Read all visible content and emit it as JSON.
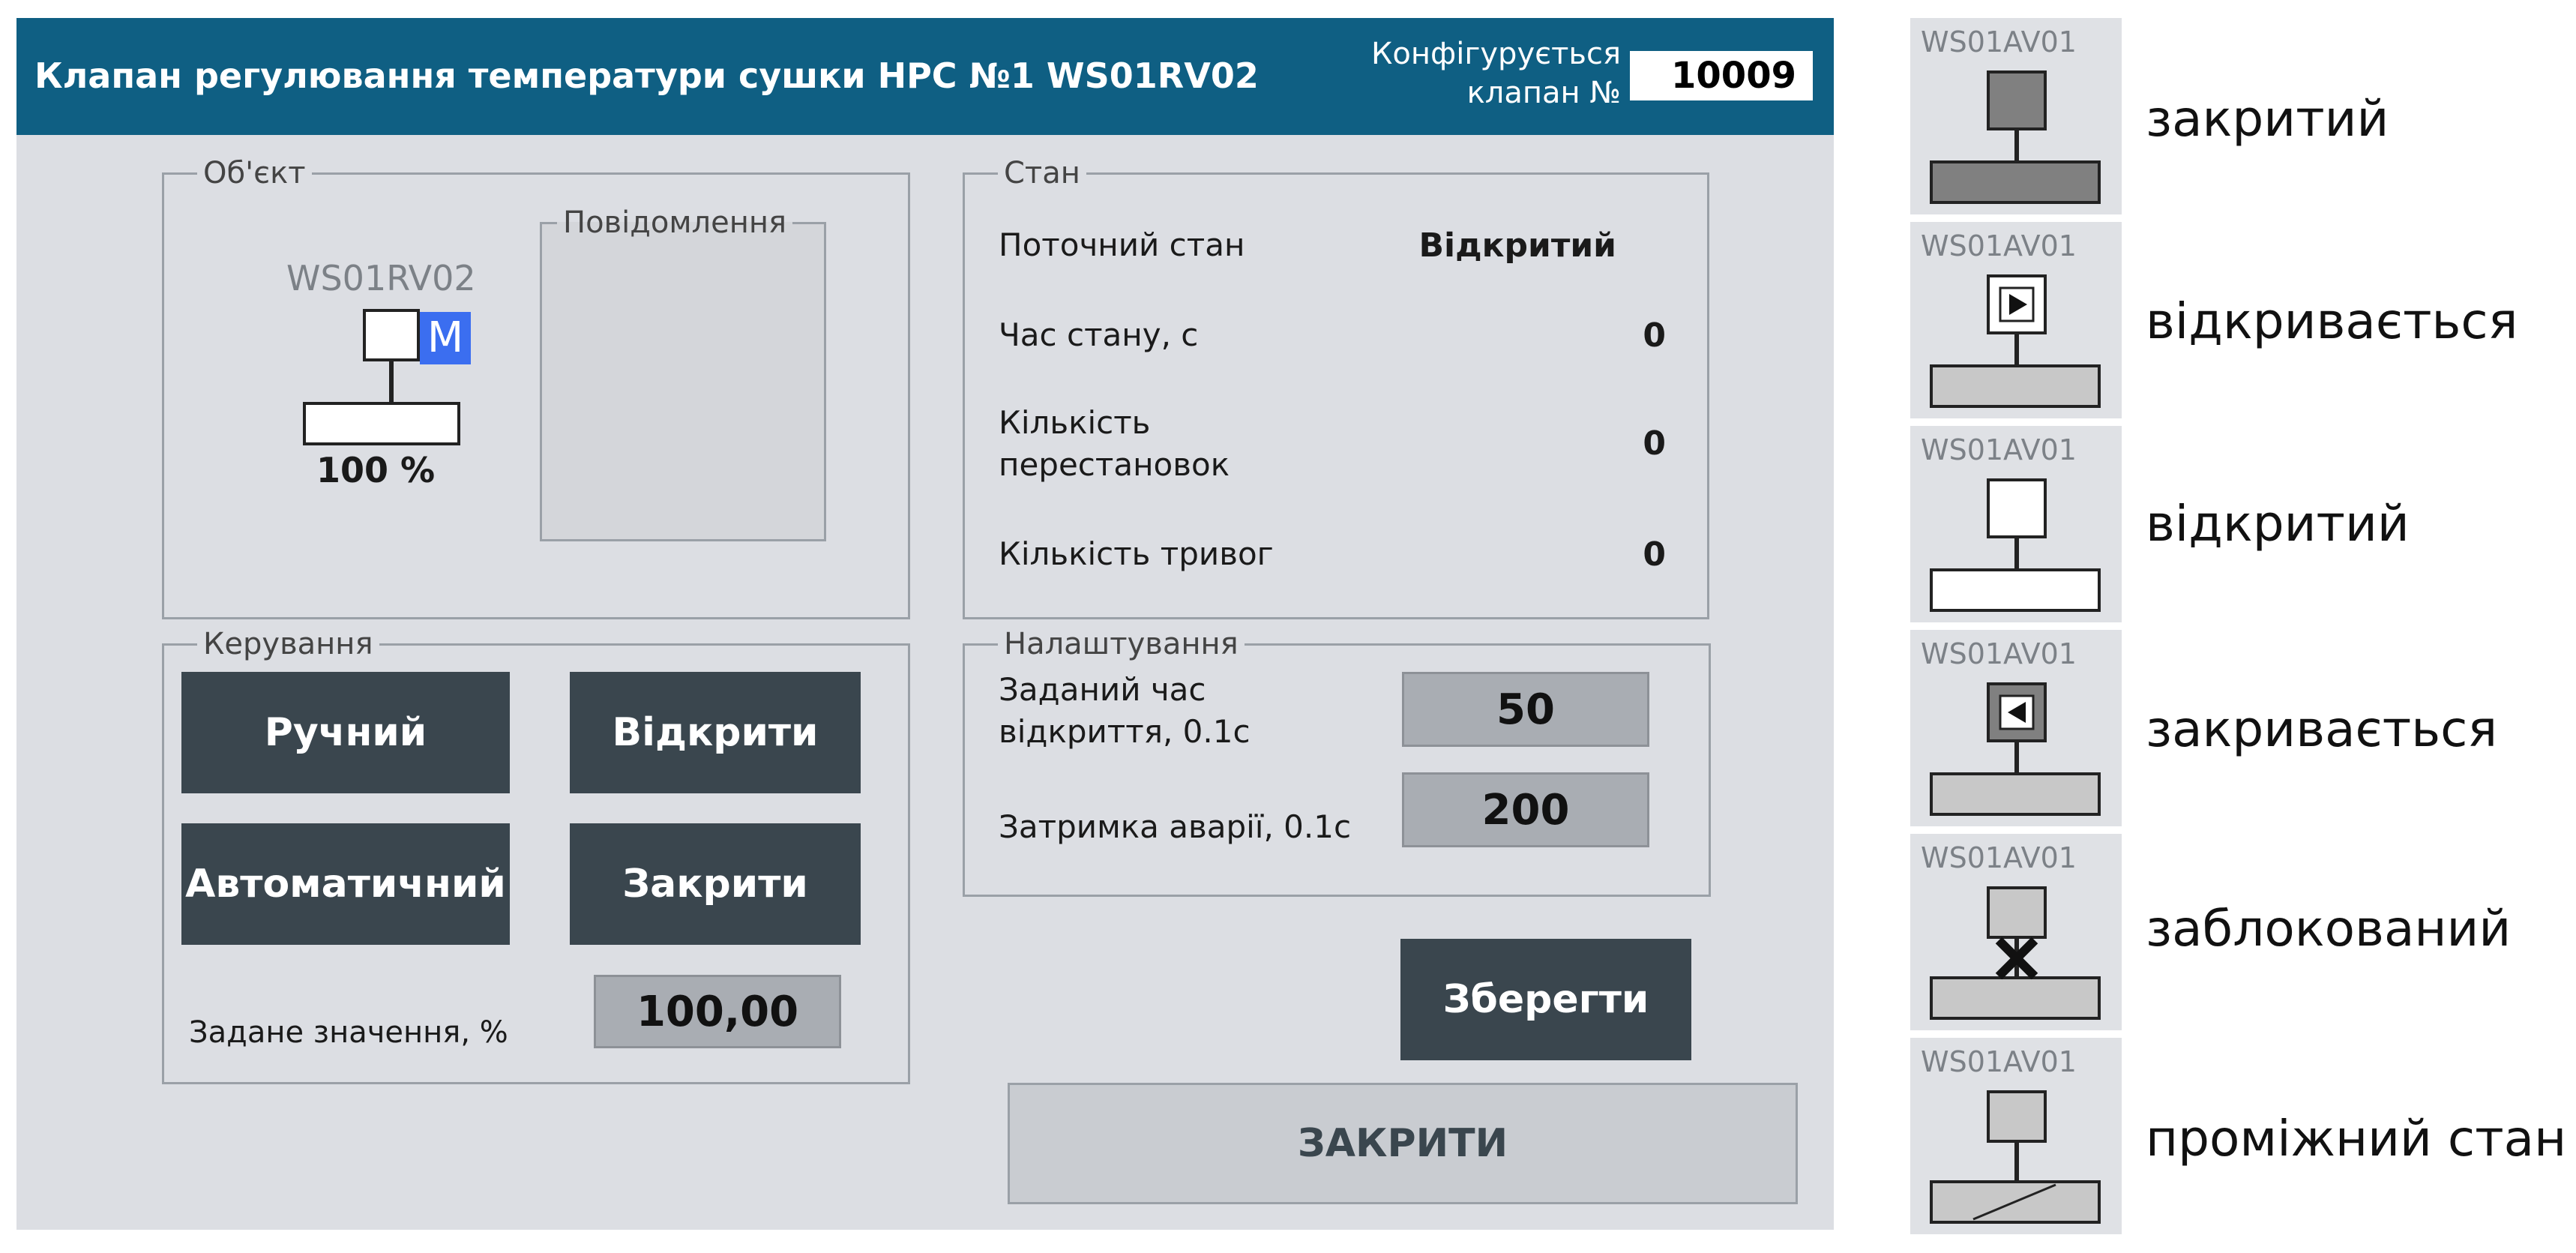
{
  "window": {
    "title": "Клапан регулювання температури сушки НРС №1 WS01RV02",
    "config_label_line1": "Конфігурується",
    "config_label_line2": "клапан №",
    "config_value": "10009"
  },
  "object_group": {
    "legend": "Об'єкт",
    "valve_tag": "WS01RV02",
    "mode_badge": "M",
    "position_percent": "100 %",
    "messages_legend": "Повідомлення"
  },
  "state_group": {
    "legend": "Стан",
    "current_state_label": "Поточний стан",
    "current_state_value": "Відкритий",
    "state_time_label": "Час стану, с",
    "state_time_value": "0",
    "switch_count_label_line1": "Кількість",
    "switch_count_label_line2": "перестановок",
    "switch_count_value": "0",
    "alarm_count_label": "Кількість тривог",
    "alarm_count_value": "0"
  },
  "control_group": {
    "legend": "Керування",
    "manual_button": "Ручний",
    "open_button": "Відкрити",
    "auto_button": "Автоматичний",
    "close_button": "Закрити",
    "setpoint_label": "Задане значення, %",
    "setpoint_value": "100,00"
  },
  "settings_group": {
    "legend": "Налаштування",
    "open_time_label_line1": "Заданий час",
    "open_time_label_line2": "відкриття, 0.1с",
    "open_time_value": "50",
    "alarm_delay_label": "Затримка аварії, 0.1с",
    "alarm_delay_value": "200"
  },
  "save_button": "Зберегти",
  "close_window_button": "ЗАКРИТИ",
  "legend_items": [
    {
      "tag": "WS01AV01",
      "label": "закритий",
      "state": "closed"
    },
    {
      "tag": "WS01AV01",
      "label": "відкривається",
      "state": "opening"
    },
    {
      "tag": "WS01AV01",
      "label": "відкритий",
      "state": "open"
    },
    {
      "tag": "WS01AV01",
      "label": "закривається",
      "state": "closing"
    },
    {
      "tag": "WS01AV01",
      "label": "заблокований",
      "state": "blocked"
    },
    {
      "tag": "WS01AV01",
      "label": "проміжний стан",
      "state": "intermediate"
    }
  ],
  "colors": {
    "title_bar": "#0f5f83",
    "panel_bg": "#dcdee3",
    "dark_button": "#3a464e",
    "mode_badge": "#3b6ef0",
    "value_field": "#a9adb3"
  }
}
